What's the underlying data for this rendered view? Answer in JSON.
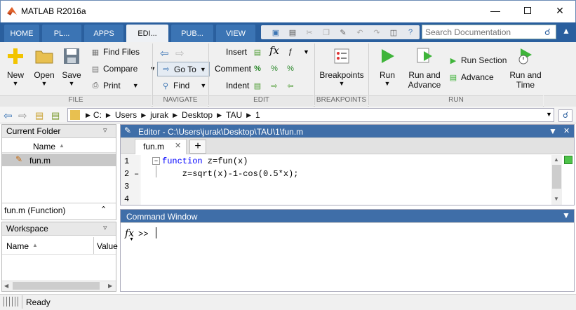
{
  "window": {
    "title": "MATLAB R2016a",
    "minimize_icon": "minimize-icon",
    "maximize_icon": "maximize-icon",
    "close_icon": "close-icon"
  },
  "tabs": [
    {
      "label": "HOME"
    },
    {
      "label": "PL..."
    },
    {
      "label": "APPS"
    },
    {
      "label": "EDI..."
    },
    {
      "label": "PUB..."
    },
    {
      "label": "VIEW"
    }
  ],
  "search": {
    "placeholder": "Search Documentation"
  },
  "toolstrip": {
    "file": {
      "section": "FILE",
      "new": "New",
      "open": "Open",
      "save": "Save",
      "find_files": "Find Files",
      "compare": "Compare",
      "print": "Print"
    },
    "navigate": {
      "section": "NAVIGATE",
      "goto": "Go To",
      "find": "Find"
    },
    "edit": {
      "section": "EDIT",
      "insert": "Insert",
      "comment": "Comment",
      "indent": "Indent",
      "fx": "fx"
    },
    "breakpoints": {
      "section": "BREAKPOINTS",
      "label": "Breakpoints"
    },
    "run": {
      "section": "RUN",
      "run": "Run",
      "run_advance_1": "Run and",
      "run_advance_2": "Advance",
      "run_section": "Run Section",
      "advance": "Advance",
      "run_time_1": "Run and",
      "run_time_2": "Time"
    }
  },
  "path": {
    "segments": [
      "C:",
      "Users",
      "jurak",
      "Desktop",
      "TAU",
      "1"
    ]
  },
  "current_folder": {
    "title": "Current Folder",
    "col_name": "Name",
    "files": [
      "fun.m"
    ],
    "details": "fun.m  (Function)"
  },
  "workspace": {
    "title": "Workspace",
    "col_name": "Name",
    "col_value": "Value"
  },
  "editor": {
    "title": "Editor - C:\\Users\\jurak\\Desktop\\TAU\\1\\fun.m",
    "tab": "fun.m",
    "add_tab": "+",
    "lines": [
      {
        "num": "1",
        "mark": "",
        "kw": "function",
        "code": " z=fun(x)"
      },
      {
        "num": "2",
        "mark": "–",
        "kw": "",
        "code": "    z=sqrt(x)-1-cos(0.5*x);"
      },
      {
        "num": "3",
        "mark": "",
        "kw": "",
        "code": ""
      },
      {
        "num": "4",
        "mark": "",
        "kw": "",
        "code": ""
      }
    ]
  },
  "command_window": {
    "title": "Command Window",
    "fx": "fx",
    "prompt": ">>"
  },
  "status": {
    "text": "Ready"
  },
  "colors": {
    "accent": "#2a5f9e",
    "editor_header": "#3f6ea8",
    "keyword": "#0000ff"
  }
}
